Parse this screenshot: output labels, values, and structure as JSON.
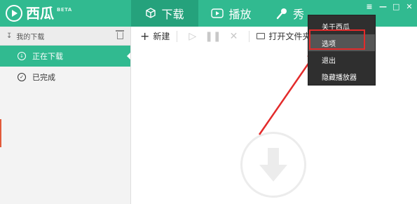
{
  "app": {
    "name": "西瓜",
    "badge": "BETA",
    "colors": {
      "primary": "#31ba90",
      "primary_dark": "#25a27c",
      "menu_bg": "#2f2f2f",
      "annotation": "#e32b2b"
    }
  },
  "tabs": [
    {
      "label": "下载",
      "icon": "box-icon",
      "active": true
    },
    {
      "label": "播放",
      "icon": "play-icon",
      "active": false
    },
    {
      "label": "秀",
      "icon": "microphone-icon",
      "active": false
    }
  ],
  "window_controls": [
    "menu-icon",
    "minimize-icon",
    "maximize-icon",
    "close-icon"
  ],
  "sidebar": {
    "header": "我的下载",
    "items": [
      {
        "label": "正在下载",
        "icon": "download-circle-icon",
        "active": true
      },
      {
        "label": "已完成",
        "icon": "check-circle-icon",
        "active": false
      }
    ]
  },
  "toolbar": {
    "new_label": "新建",
    "open_folder_label": "打开文件夹"
  },
  "menu": {
    "items": [
      {
        "label": "关于西瓜"
      },
      {
        "label": "选项",
        "highlighted": true
      },
      {
        "label": "退出"
      },
      {
        "label": "隐藏播放器"
      }
    ]
  }
}
